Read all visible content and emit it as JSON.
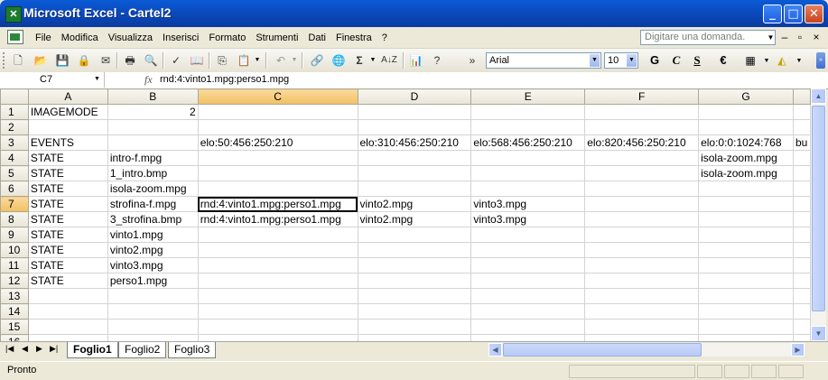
{
  "window": {
    "title": "Microsoft Excel - Cartel2",
    "app_icon": "excel-icon",
    "controls": [
      "minimize",
      "maximize",
      "close"
    ]
  },
  "menu": {
    "items": [
      "File",
      "Modifica",
      "Visualizza",
      "Inserisci",
      "Formato",
      "Strumenti",
      "Dati",
      "Finestra",
      "?"
    ],
    "help_placeholder": "Digitare una domanda."
  },
  "toolbar": {
    "font_name": "Arial",
    "font_size": "10",
    "bold_label": "G",
    "italic_label": "C",
    "underline_label": "S",
    "sum_label": "Σ",
    "currency_label": "€"
  },
  "formula_bar": {
    "name_box": "C7",
    "fx_label": "fx",
    "content": "rnd:4:vinto1.mpg:perso1.mpg"
  },
  "sheet": {
    "columns": [
      "A",
      "B",
      "C",
      "D",
      "E",
      "F",
      "G"
    ],
    "selected_column": "C",
    "selected_row": "7",
    "rows": [
      {
        "n": "1",
        "cells": [
          "IMAGEMODE",
          "2",
          "",
          "",
          "",
          "",
          ""
        ]
      },
      {
        "n": "2",
        "cells": [
          "",
          "",
          "",
          "",
          "",
          "",
          ""
        ]
      },
      {
        "n": "3",
        "cells": [
          "EVENTS",
          "",
          "elo:50:456:250:210",
          "elo:310:456:250:210",
          "elo:568:456:250:210",
          "elo:820:456:250:210",
          "elo:0:0:1024:768"
        ]
      },
      {
        "n": "4",
        "cells": [
          "STATE",
          "intro-f.mpg",
          "",
          "",
          "",
          "",
          "isola-zoom.mpg"
        ]
      },
      {
        "n": "5",
        "cells": [
          "STATE",
          "1_intro.bmp",
          "",
          "",
          "",
          "",
          "isola-zoom.mpg"
        ]
      },
      {
        "n": "6",
        "cells": [
          "STATE",
          "isola-zoom.mpg",
          "",
          "",
          "",
          "",
          ""
        ]
      },
      {
        "n": "7",
        "cells": [
          "STATE",
          "strofina-f.mpg",
          "rnd:4:vinto1.mpg:perso1.mpg",
          "vinto2.mpg",
          "vinto3.mpg",
          "",
          ""
        ]
      },
      {
        "n": "8",
        "cells": [
          "STATE",
          "3_strofina.bmp",
          "rnd:4:vinto1.mpg:perso1.mpg",
          "vinto2.mpg",
          "vinto3.mpg",
          "",
          ""
        ]
      },
      {
        "n": "9",
        "cells": [
          "STATE",
          "vinto1.mpg",
          "",
          "",
          "",
          "",
          ""
        ]
      },
      {
        "n": "10",
        "cells": [
          "STATE",
          "vinto2.mpg",
          "",
          "",
          "",
          "",
          ""
        ]
      },
      {
        "n": "11",
        "cells": [
          "STATE",
          "vinto3.mpg",
          "",
          "",
          "",
          "",
          ""
        ]
      },
      {
        "n": "12",
        "cells": [
          "STATE",
          "perso1.mpg",
          "",
          "",
          "",
          "",
          ""
        ]
      },
      {
        "n": "13",
        "cells": [
          "",
          "",
          "",
          "",
          "",
          "",
          ""
        ]
      },
      {
        "n": "14",
        "cells": [
          "",
          "",
          "",
          "",
          "",
          "",
          ""
        ]
      },
      {
        "n": "15",
        "cells": [
          "",
          "",
          "",
          "",
          "",
          "",
          ""
        ]
      },
      {
        "n": "16",
        "cells": [
          "",
          "",
          "",
          "",
          "",
          "",
          ""
        ]
      }
    ],
    "overflow_h3": "bu"
  },
  "sheet_tabs": [
    "Foglio1",
    "Foglio2",
    "Foglio3"
  ],
  "active_tab": "Foglio1",
  "status": {
    "text": "Pronto"
  }
}
